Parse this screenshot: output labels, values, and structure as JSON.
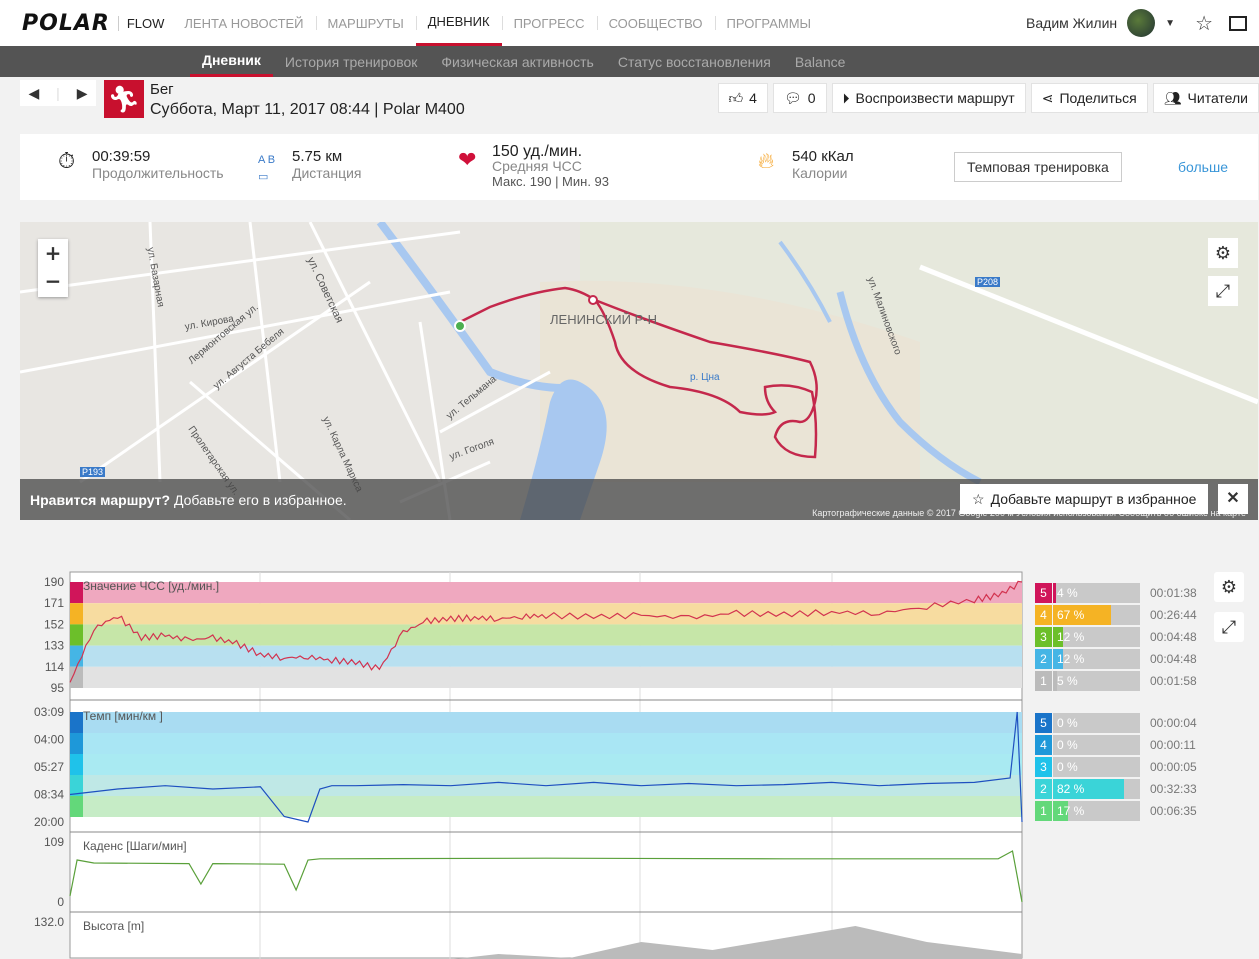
{
  "header": {
    "logo": "POLAR",
    "flow": "FLOW",
    "nav": [
      "ЛЕНТА НОВОСТЕЙ",
      "МАРШРУТЫ",
      "ДНЕВНИК",
      "ПРОГРЕСС",
      "СООБЩЕСТВО",
      "ПРОГРАММЫ"
    ],
    "active": 2,
    "user": "Вадим Жилин"
  },
  "subnav": {
    "items": [
      "Дневник",
      "История тренировок",
      "Физическая активность",
      "Статус восстановления",
      "Balance"
    ],
    "active": 0
  },
  "session": {
    "sport": "Бег",
    "details": "Суббота, Март 11, 2017 08:44 | Polar M400"
  },
  "actions": {
    "likes": "4",
    "comments": "0",
    "replay": "Воспроизвести маршрут",
    "share": "Поделиться",
    "followers": "Читатели"
  },
  "summary": {
    "duration": "00:39:59",
    "duration_label": "Продолжительность",
    "distance": "5.75 км",
    "distance_label": "Дистанция",
    "hr": "150 уд./мин.",
    "hr_label": "Средняя ЧСС",
    "hr_minmax": "Макс. 190  |  Мин. 93",
    "calories": "540 кКал",
    "calories_label": "Калории",
    "type": "Темповая тренировка",
    "more": "больше"
  },
  "map": {
    "prompt_bold": "Нравится маршрут?",
    "prompt": "Добавьте его в избранное.",
    "fav_button": "Добавьте маршрут в избранное",
    "copyright": "Картографические данные © 2017 Google   200 м   Условия использования   Сообщить об ошибке на карте",
    "labels": [
      "ЛЕНИНСКИЙ Р-Н",
      "ул. Советская",
      "ул. Кирова",
      "ул. Базарная",
      "Лермонтовская ул.",
      "ул. Августа Бебеля",
      "Пролетарская ул.",
      "ул. Карла Маркса",
      "ул. Тельмана",
      "ул. Гоголя",
      "р. Цна",
      "Р208",
      "Р193",
      "ул. Малиновского"
    ]
  },
  "zones": {
    "hr": [
      {
        "n": "5",
        "pct": "4 %",
        "v": 4,
        "time": "00:01:38",
        "c": "#d0155a"
      },
      {
        "n": "4",
        "pct": "67 %",
        "v": 67,
        "time": "00:26:44",
        "c": "#f5b324"
      },
      {
        "n": "3",
        "pct": "12 %",
        "v": 12,
        "time": "00:04:48",
        "c": "#6cbf2a"
      },
      {
        "n": "2",
        "pct": "12 %",
        "v": 12,
        "time": "00:04:48",
        "c": "#45b5e5"
      },
      {
        "n": "1",
        "pct": "5 %",
        "v": 5,
        "time": "00:01:58",
        "c": "#bbbbbb"
      }
    ],
    "pace": [
      {
        "n": "5",
        "pct": "0 %",
        "v": 0,
        "time": "00:00:04",
        "c": "#1a74c9"
      },
      {
        "n": "4",
        "pct": "0 %",
        "v": 0,
        "time": "00:00:11",
        "c": "#1e98d9"
      },
      {
        "n": "3",
        "pct": "0 %",
        "v": 0,
        "time": "00:00:05",
        "c": "#1fc2ea"
      },
      {
        "n": "2",
        "pct": "82 %",
        "v": 82,
        "time": "00:32:33",
        "c": "#3ad4d8"
      },
      {
        "n": "1",
        "pct": "17 %",
        "v": 17,
        "time": "00:06:35",
        "c": "#63d87a"
      }
    ]
  },
  "chart_data": [
    {
      "type": "line",
      "title": "Значение ЧСС [уд./мин.]",
      "yticks": [
        "190",
        "171",
        "152",
        "133",
        "114",
        "95"
      ],
      "ylim": [
        95,
        190
      ],
      "color": "#d2334f",
      "x": [
        0,
        1,
        2,
        3,
        4,
        5,
        6,
        7,
        8,
        9,
        10,
        11,
        12,
        13,
        14,
        15,
        16,
        17,
        18,
        19,
        20,
        22,
        24,
        26,
        28,
        30,
        32,
        34,
        36,
        38,
        39,
        40
      ],
      "values": [
        100,
        148,
        160,
        140,
        142,
        138,
        140,
        135,
        125,
        122,
        123,
        120,
        118,
        112,
        145,
        155,
        157,
        158,
        157,
        159,
        160,
        159,
        160,
        158,
        162,
        161,
        163,
        162,
        168,
        174,
        178,
        190
      ]
    },
    {
      "type": "line",
      "title": "Темп [мин/км ]",
      "yticks": [
        "03:09",
        "04:00",
        "05:27",
        "08:34",
        "20:00"
      ],
      "color": "#1e50c0",
      "x": [
        0,
        2,
        4,
        6,
        8,
        9,
        10,
        10.5,
        11,
        12,
        14,
        16,
        18,
        20,
        22,
        24,
        26,
        28,
        30,
        32,
        34,
        36,
        38,
        39.5,
        39.8,
        40
      ],
      "values": [
        0.25,
        0.3,
        0.33,
        0.3,
        0.32,
        0.05,
        0,
        0.3,
        0.33,
        0.33,
        0.34,
        0.33,
        0.36,
        0.33,
        0.36,
        0.33,
        0.35,
        0.33,
        0.34,
        0.36,
        0.33,
        0.35,
        0.36,
        0.4,
        1,
        0
      ]
    },
    {
      "type": "line",
      "title": "Каденс [Шаги/мин]",
      "yticks": [
        "109",
        "0"
      ],
      "color": "#5aa03a",
      "x": [
        0,
        0.3,
        1,
        5,
        5.5,
        6,
        9,
        9.5,
        10,
        10.5,
        20,
        30,
        39,
        39.6,
        40
      ],
      "values": [
        0.1,
        0.7,
        0.65,
        0.64,
        0.3,
        0.64,
        0.63,
        0.2,
        0.7,
        0.72,
        0.73,
        0.72,
        0.72,
        0.85,
        0
      ]
    },
    {
      "type": "area",
      "title": "Высота [m]",
      "yticks": [
        "132.0"
      ],
      "color": "#bbbbbb",
      "x": [
        0,
        15,
        18,
        21,
        24,
        27,
        30,
        33,
        36,
        40
      ],
      "values": [
        0,
        0,
        0.2,
        0.1,
        0.5,
        0.3,
        0.6,
        0.9,
        0.5,
        0.2
      ]
    }
  ]
}
